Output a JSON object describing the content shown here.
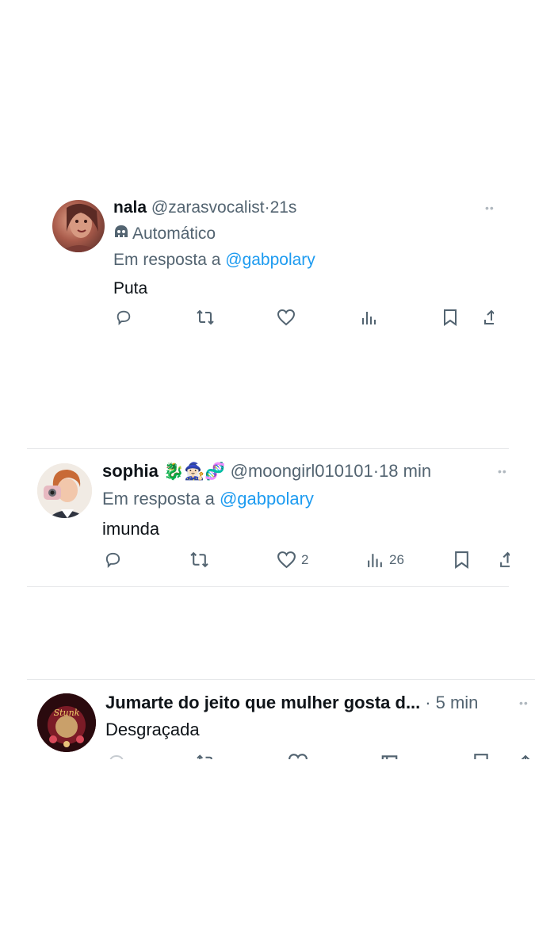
{
  "tweets": [
    {
      "name": "nala",
      "handle": "@zarasvocalist",
      "sep": "·",
      "time": "21s",
      "label": "Automático",
      "reply_prefix": "Em resposta a",
      "reply_to": "@gabpolary",
      "text": "Puta",
      "likes": "",
      "views": ""
    },
    {
      "name": "sophia",
      "emojis": "🐉🧙🏻‍♀️🧬",
      "handle": "@moongirl010101",
      "sep": "·",
      "time": "18 min",
      "reply_prefix": "Em resposta a",
      "reply_to": "@gabpolary",
      "text": "imunda",
      "likes": "2",
      "views": "26"
    },
    {
      "name": "Jumarte do jeito que mulher gosta d...",
      "sep": "·",
      "time": "5 min",
      "text": "Desgraçada"
    }
  ],
  "icons": {
    "reply": "reply-icon",
    "retweet": "retweet-icon",
    "like": "heart-icon",
    "views": "views-icon",
    "bookmark": "bookmark-icon",
    "share": "share-icon",
    "bot": "bot-icon",
    "more": "more-icon"
  },
  "colors": {
    "link": "#1d9bf0",
    "muted": "#536471",
    "text": "#0f1419"
  }
}
